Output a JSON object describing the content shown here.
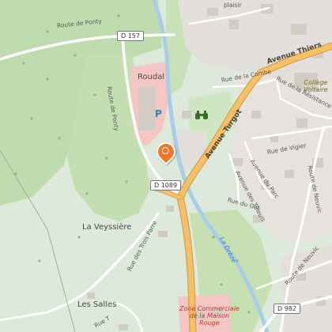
{
  "map": {
    "colors": {
      "forest": "#bfdcae",
      "meadow": "#ddeadb",
      "urban": "#e3dfda",
      "retail": "#f4c7c4",
      "river": "#a9cde6",
      "road_major": "#f7c068",
      "road_minor": "#ffffff",
      "building": "#d2ccc4",
      "pin": "#f0772a",
      "parking": "#2a7fd4"
    },
    "places": {
      "roudal": "Roudal",
      "la_veyssiere": "La Veyssière",
      "les_salles": "Les Salles",
      "college_line1": "Collège",
      "college_line2": "Voltaire",
      "zone_line1": "Zone Commerciale",
      "zone_line2": "de la Maison",
      "zone_line3": "Rouge"
    },
    "streets": {
      "route_de_ponty_top": "Route de Ponty",
      "route_de_ponty_side": "Route de Ponty",
      "avenue_thiers": "Avenue Thiers",
      "avenue_turgot": "Avenue Turgot",
      "rue_de_la_combe": "Rue de la Combe",
      "rue_de_la_resistance": "Rue de la Résistance",
      "rue_de_vigier": "Rue de Vigier",
      "avenue_du_parc": "Avenue du Parc",
      "avenue_des_tilleuls": "Avenue des Tilleuls",
      "rue_du_got": "Rue du Got",
      "rue_des_trois_parre": "Rue des Trois Parre",
      "route_de_neuvic_right": "Route de Neuvic",
      "route_de_neuvic_bottom": "Route de Neuvic",
      "plaisir": "plaisir",
      "rue_t": "Rue T"
    },
    "roads": {
      "d157": "D 157",
      "d1089": "D 1089",
      "d982": "D 982"
    },
    "water": {
      "la_dreze": "La Drèze"
    },
    "markers": {
      "parking_label": "P",
      "pin_icon": "map-pin-icon",
      "binoculars_icon": "binoculars-icon"
    }
  }
}
